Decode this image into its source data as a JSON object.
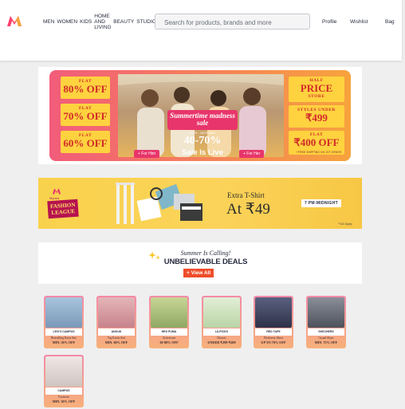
{
  "header": {
    "nav": [
      "MEN",
      "WOMEN",
      "KIDS",
      "HOME AND LIVING",
      "BEAUTY",
      "STUDIO"
    ],
    "search_placeholder": "Search for products, brands and more",
    "profile": "Profile",
    "wishlist": "Wishlist",
    "bag": "Bag"
  },
  "banner_sale": {
    "offers_left": [
      {
        "small": "FLAT",
        "big": "80% OFF"
      },
      {
        "small": "FLAT",
        "big": "70% OFF"
      },
      {
        "small": "FLAT",
        "big": "60% OFF"
      }
    ],
    "half_price": {
      "small": "HALF",
      "big": "PRICE",
      "tail": "STORE"
    },
    "styles_under": {
      "small": "STYLES UNDER",
      "big": "₹499"
    },
    "flat_400": {
      "small": "FLAT",
      "big": "₹400 OFF"
    },
    "fine_print": "+FREE SHIPPING ON 1ST ORDER",
    "title": "Summertime madness sale",
    "dates": "11TH - 16TH MAY",
    "discount": "40-70%",
    "live": "Sale Is Live",
    "for_him": "+ For Him",
    "for_her": "+ For Her"
  },
  "banner_league": {
    "myntra": "Myntra",
    "league": "FASHION LEAGUE",
    "extra": "Extra T-Shirt",
    "price": "At ₹49",
    "time": "7 PM-MIDNIGHT",
    "tnc": "*T&C Apply"
  },
  "banner_deals": {
    "calling": "Summer Is Calling!",
    "deals": "UNBELIEVABLE DEALS",
    "view_all": "+ View All"
  },
  "deal_cards": [
    {
      "brand": "LEVI'S  CAMPUS",
      "label": "Bestselling Kurta Sets",
      "offer": "MIN. 50% OFF",
      "img": "#8fb3d6"
    },
    {
      "brand": "ANOUK",
      "label": "Top Kurtis Sets",
      "offer": "MIN. 60% OFF",
      "img": "#d89aa0"
    },
    {
      "brand": "HRX  PUMA",
      "label": "Activewear",
      "offer": "30-80% OFF",
      "img": "#b6c97a"
    },
    {
      "brand": "LILPICKS",
      "label": "Dresses",
      "offer": "UNDER ₹299-₹499",
      "img": "#cfe3c0"
    },
    {
      "brand": "RED TAPE",
      "label": "Workwear Shoes",
      "offer": "UP TO 70% OFF",
      "img": "#4a4f6a"
    },
    {
      "brand": "SKECHERS",
      "label": "Casual Shoes",
      "offer": "MIN. 75% OFF",
      "img": "#6a6e78"
    },
    {
      "brand": "CAMPUS",
      "label": "Footwear",
      "offer": "MIN. 30% OFF",
      "img": "#d9d9d9"
    }
  ]
}
